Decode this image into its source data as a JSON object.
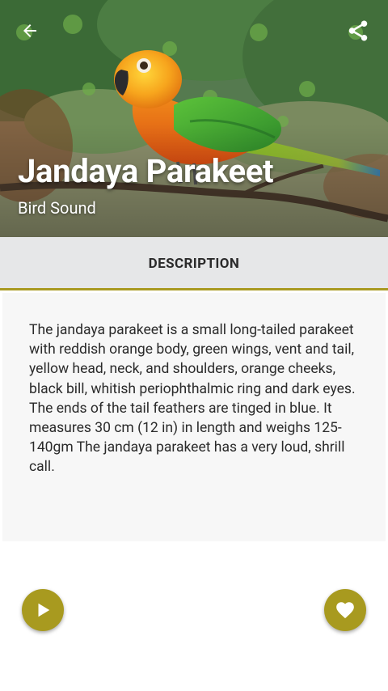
{
  "hero": {
    "title": "Jandaya Parakeet",
    "subtitle": "Bird Sound",
    "back_icon": "arrow-left-icon",
    "share_icon": "share-icon",
    "image_subject": "jandaya parakeet perched on a branch"
  },
  "tabs": [
    {
      "label": "DESCRIPTION",
      "selected": true
    }
  ],
  "description": {
    "text": "The jandaya parakeet is a small long-tailed parakeet with reddish orange body, green wings, vent and tail, yellow head, neck, and shoulders, orange cheeks, black bill, whitish periophthalmic ring and dark eyes. The ends of the tail feathers are tinged in blue. It measures 30 cm (12 in) in length and weighs 125-140gm The jandaya parakeet has a very loud, shrill call."
  },
  "actions": {
    "play_icon": "play-icon",
    "favorite_icon": "heart-icon"
  },
  "colors": {
    "accent": "#a89a1f",
    "tab_background": "#e6e7e8",
    "card_background": "#f7f7f7"
  }
}
